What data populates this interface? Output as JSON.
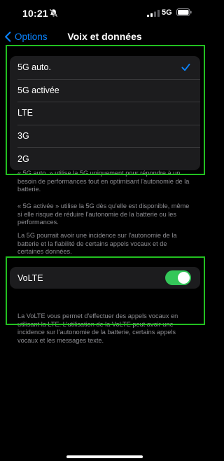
{
  "status_bar": {
    "time": "10:21",
    "network": "5G",
    "silent_icon": "bell-slash-icon",
    "signal_icon": "cellular-signal-icon",
    "battery_icon": "battery-icon"
  },
  "nav": {
    "back_label": "Options",
    "title": "Voix et données"
  },
  "modes": {
    "items": [
      {
        "label": "5G auto.",
        "selected": true
      },
      {
        "label": "5G activée",
        "selected": false
      },
      {
        "label": "LTE",
        "selected": false
      },
      {
        "label": "3G",
        "selected": false
      },
      {
        "label": "2G",
        "selected": false
      }
    ]
  },
  "footnotes": {
    "auto": "« 5G auto. » utilise la 5G uniquement pour répondre à un besoin de performances tout en optimisant l'autonomie de la batterie.",
    "on": "« 5G activée » utilise la 5G dès qu'elle est disponible, même si elle risque de réduire l'autonomie de la batterie ou les performances.",
    "impact": "La 5G pourrait avoir une incidence sur l'autonomie de la batterie et la fiabilité de certains appels vocaux et de certaines données.",
    "volte": "La VoLTE vous permet d'effectuer des appels vocaux en utilisant la LTE. L'utilisation de la VoLTE peut avoir une incidence sur l'autonomie de la batterie, certains appels vocaux et les messages texte."
  },
  "volte": {
    "label": "VoLTE",
    "enabled": true
  },
  "colors": {
    "accent": "#0a84ff",
    "toggle_on": "#34c759",
    "highlight_box": "#22c020",
    "cell_bg": "#1c1c1e",
    "secondary_text": "#8e8e93"
  }
}
